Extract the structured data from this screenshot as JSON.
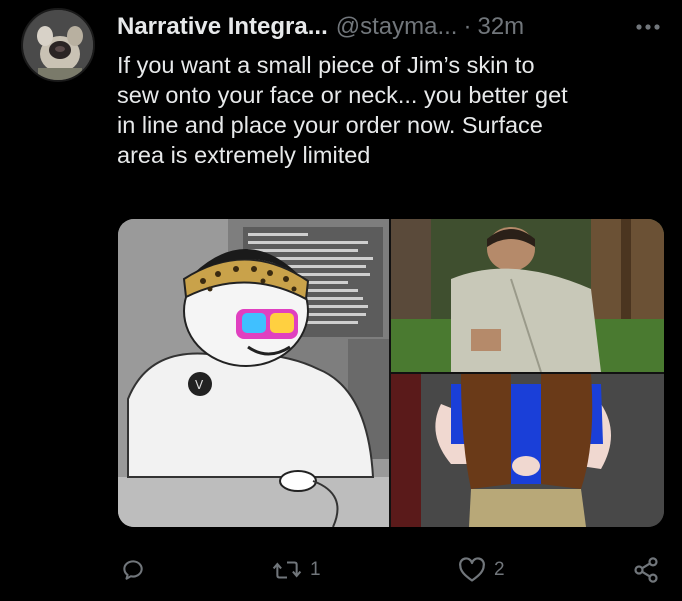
{
  "tweet": {
    "author_name": "Narrative Integra...",
    "handle": "@stayma...",
    "separator": "·",
    "time": "32m",
    "text": "If you want a small piece of Jim’s skin to\nsew onto your face or neck... you better get\nin line and place your order now. Surface\narea is extremely limited"
  },
  "media": {
    "tiles": [
      {
        "kind": "illustration",
        "position": "left"
      },
      {
        "kind": "photo",
        "position": "top-right"
      },
      {
        "kind": "illustration",
        "position": "bottom-right"
      }
    ]
  },
  "actions": {
    "reply_count": "",
    "retweet_count": "1",
    "like_count": "2"
  },
  "icons": [
    "more-icon",
    "reply-icon",
    "retweet-icon",
    "like-icon",
    "share-icon"
  ],
  "colors": {
    "background": "#000000",
    "text": "#e7e9ea",
    "muted": "#71767b"
  }
}
